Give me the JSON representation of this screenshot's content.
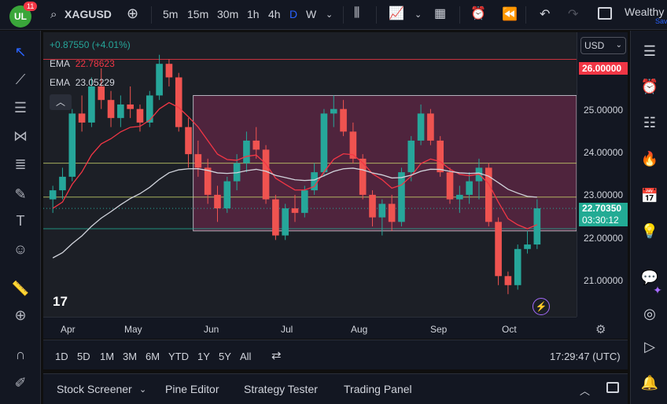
{
  "header": {
    "badge_count": "11",
    "logo_text": "UL",
    "symbol": "XAGUSD",
    "timeframes": [
      "5m",
      "15m",
      "30m",
      "1h",
      "4h",
      "D",
      "W"
    ],
    "active_timeframe": "D",
    "account_name": "Wealthy",
    "account_sub": "Sav"
  },
  "legend": {
    "change": "+0.87550 (+4.01%)",
    "ema1_label": "EMA",
    "ema1_value": "22.78623",
    "ema2_label": "EMA",
    "ema2_value": "23.05229"
  },
  "price_axis": {
    "currency": "USD",
    "labels": [
      "25.00000",
      "24.00000",
      "23.00000",
      "22.00000",
      "21.00000"
    ],
    "top_tag": "26.00000",
    "current_price": "22.70350",
    "countdown": "03:30:12"
  },
  "time_axis": {
    "labels": [
      "Apr",
      "May",
      "Jun",
      "Jul",
      "Aug",
      "Sep",
      "Oct"
    ]
  },
  "bottom_bar": {
    "ranges": [
      "1D",
      "5D",
      "1M",
      "3M",
      "6M",
      "YTD",
      "1Y",
      "5Y",
      "All"
    ],
    "clock": "17:29:47 (UTC)"
  },
  "panel_tabs": [
    "Stock Screener",
    "Pine Editor",
    "Strategy Tester",
    "Trading Panel"
  ],
  "colors": {
    "up": "#26a69a",
    "down": "#ef5350",
    "ema_fast": "#f23645",
    "ema_slow": "#d1d4dc",
    "range_box": "#8e2a5a",
    "accent": "#2962ff"
  },
  "chart_data": {
    "type": "candlestick",
    "y_range": [
      20.3,
      26.6
    ],
    "x_labels": [
      "Apr",
      "May",
      "Jun",
      "Jul",
      "Aug",
      "Sep",
      "Oct"
    ],
    "horizontal_levels": [
      26.0,
      23.7,
      22.95,
      22.25
    ],
    "range_box": {
      "from": "Jun",
      "to": "Oct",
      "top": 25.2,
      "bottom": 22.2
    },
    "candles": [
      [
        22.9,
        23.2,
        22.6,
        23.1
      ],
      [
        23.1,
        23.6,
        22.9,
        23.4
      ],
      [
        23.4,
        24.9,
        23.3,
        24.8
      ],
      [
        24.8,
        25.2,
        24.4,
        24.6
      ],
      [
        24.6,
        25.6,
        24.5,
        25.4
      ],
      [
        25.4,
        25.8,
        24.9,
        25.1
      ],
      [
        25.1,
        25.3,
        24.5,
        24.7
      ],
      [
        24.7,
        25.2,
        24.5,
        25.0
      ],
      [
        25.0,
        25.4,
        24.7,
        24.9
      ],
      [
        24.9,
        25.0,
        24.4,
        24.6
      ],
      [
        24.6,
        25.3,
        24.5,
        25.2
      ],
      [
        25.2,
        26.1,
        25.1,
        25.9
      ],
      [
        25.9,
        26.0,
        25.4,
        25.6
      ],
      [
        25.6,
        25.7,
        24.4,
        24.5
      ],
      [
        24.5,
        24.7,
        23.6,
        23.9
      ],
      [
        23.9,
        24.2,
        23.4,
        23.6
      ],
      [
        23.6,
        23.8,
        22.8,
        23.0
      ],
      [
        23.0,
        23.2,
        22.4,
        22.7
      ],
      [
        22.7,
        23.4,
        22.6,
        23.3
      ],
      [
        23.3,
        23.9,
        23.1,
        23.7
      ],
      [
        23.7,
        24.4,
        23.5,
        24.2
      ],
      [
        24.2,
        24.5,
        23.8,
        24.0
      ],
      [
        24.0,
        24.1,
        22.8,
        22.9
      ],
      [
        22.9,
        23.0,
        22.0,
        22.1
      ],
      [
        22.1,
        22.8,
        22.0,
        22.7
      ],
      [
        22.7,
        23.0,
        22.4,
        22.6
      ],
      [
        22.6,
        23.2,
        22.5,
        23.1
      ],
      [
        23.1,
        23.7,
        23.0,
        23.5
      ],
      [
        23.5,
        24.9,
        23.4,
        24.8
      ],
      [
        24.8,
        25.2,
        24.5,
        24.9
      ],
      [
        24.9,
        25.1,
        24.3,
        24.4
      ],
      [
        24.4,
        24.6,
        23.7,
        23.8
      ],
      [
        23.8,
        23.9,
        22.9,
        23.0
      ],
      [
        23.0,
        23.1,
        22.3,
        22.5
      ],
      [
        22.5,
        22.9,
        22.1,
        22.8
      ],
      [
        22.8,
        23.0,
        22.2,
        22.4
      ],
      [
        22.4,
        23.6,
        22.3,
        23.5
      ],
      [
        23.5,
        24.3,
        23.3,
        24.2
      ],
      [
        24.2,
        25.0,
        24.1,
        24.8
      ],
      [
        24.8,
        24.9,
        24.1,
        24.2
      ],
      [
        24.2,
        24.3,
        23.4,
        23.5
      ],
      [
        23.5,
        23.6,
        22.8,
        22.9
      ],
      [
        22.9,
        23.2,
        22.6,
        23.0
      ],
      [
        23.0,
        23.5,
        22.8,
        23.3
      ],
      [
        23.3,
        23.8,
        22.9,
        23.6
      ],
      [
        23.6,
        23.7,
        22.3,
        22.4
      ],
      [
        22.4,
        22.5,
        21.0,
        21.2
      ],
      [
        21.2,
        21.3,
        20.8,
        21.0
      ],
      [
        21.0,
        21.9,
        20.9,
        21.8
      ],
      [
        21.8,
        22.2,
        21.7,
        21.9
      ],
      [
        21.9,
        22.9,
        21.8,
        22.7
      ]
    ]
  }
}
